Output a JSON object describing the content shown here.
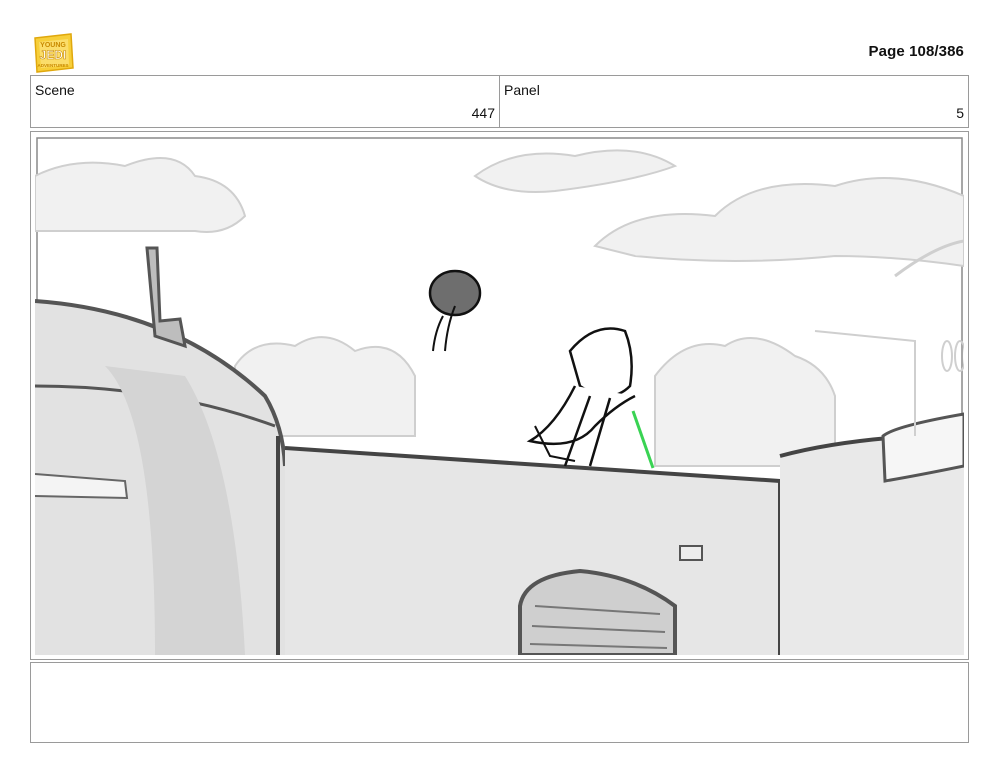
{
  "header": {
    "page_number": "Page 108/386",
    "logo": {
      "name": "young-jedi-adventures-logo",
      "text_lines": [
        "YOUNG",
        "JEDI",
        "ADVENTURES"
      ],
      "color": "#f5c51b"
    }
  },
  "info": {
    "scene_label": "Scene",
    "scene_value": "447",
    "panel_label": "Panel",
    "panel_value": "5"
  },
  "panel": {
    "image_semantic": "storyboard-sketch-rooftop-jump",
    "saber_color": "#39d353"
  },
  "notes": {
    "text": ""
  }
}
